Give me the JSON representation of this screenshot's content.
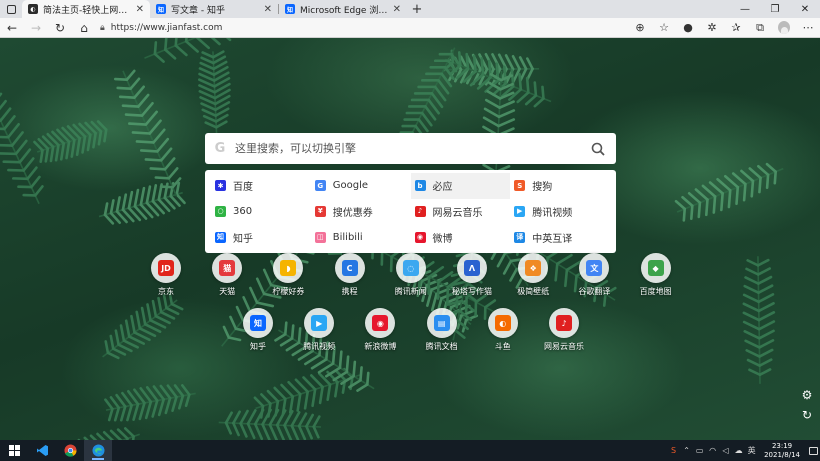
{
  "browser": {
    "tabs": [
      {
        "label": "简法主页-轻快上网体验",
        "active": true,
        "fav_color": "#2b2b2b",
        "fav_text": "◐"
      },
      {
        "label": "写文章 - 知乎",
        "active": false,
        "fav_color": "#0a66ff",
        "fav_text": "知"
      },
      {
        "label": "Microsoft Edge 浏览器及拓展插件",
        "active": false,
        "fav_color": "#0a66ff",
        "fav_text": "知"
      }
    ],
    "address": "https://www.jianfast.com"
  },
  "search": {
    "placeholder": "这里搜索，可以切换引擎",
    "logo": "G"
  },
  "engines": [
    {
      "label": "百度",
      "icon": "paw-icon",
      "color": "#2932e1",
      "glyph": "✱"
    },
    {
      "label": "Google",
      "icon": "google-icon",
      "color": "#4285f4",
      "glyph": "G"
    },
    {
      "label": "必应",
      "icon": "bing-icon",
      "color": "#1e88e5",
      "glyph": "b",
      "highlight": true
    },
    {
      "label": "搜狗",
      "icon": "sogou-icon",
      "color": "#f05a28",
      "glyph": "S"
    },
    {
      "label": "360",
      "icon": "360-icon",
      "color": "#2fb344",
      "glyph": "○"
    },
    {
      "label": "搜优惠券",
      "icon": "coupon-icon",
      "color": "#e53935",
      "glyph": "¥"
    },
    {
      "label": "网易云音乐",
      "icon": "music-icon",
      "color": "#e02020",
      "glyph": "♪"
    },
    {
      "label": "腾讯视频",
      "icon": "video-icon",
      "color": "#2aa6f4",
      "glyph": "▶"
    },
    {
      "label": "知乎",
      "icon": "zhihu-icon",
      "color": "#0a66ff",
      "glyph": "知"
    },
    {
      "label": "Bilibili",
      "icon": "bilibili-icon",
      "color": "#f37299",
      "glyph": "◫"
    },
    {
      "label": "微博",
      "icon": "weibo-icon",
      "color": "#e6162d",
      "glyph": "◉"
    },
    {
      "label": "中英互译",
      "icon": "translate-icon",
      "color": "#1e88e5",
      "glyph": "译"
    }
  ],
  "shortcuts_row1": [
    {
      "label": "京东",
      "icon": "jd-icon",
      "color": "#e1251b",
      "glyph": "JD"
    },
    {
      "label": "天猫",
      "icon": "tmall-icon",
      "color": "#e4393c",
      "glyph": "猫"
    },
    {
      "label": "柠檬好券",
      "icon": "lemon-icon",
      "color": "#f5b400",
      "glyph": "◗"
    },
    {
      "label": "携程",
      "icon": "ctrip-icon",
      "color": "#2577e3",
      "glyph": "C"
    },
    {
      "label": "腾讯新闻",
      "icon": "news-icon",
      "color": "#3ba8f0",
      "glyph": "◌"
    },
    {
      "label": "秘塔写作猫",
      "icon": "metaso-icon",
      "color": "#2a62d0",
      "glyph": "Λ"
    },
    {
      "label": "极简壁纸",
      "icon": "wallpaper-icon",
      "color": "#f08a24",
      "glyph": "❖"
    },
    {
      "label": "谷歌翻译",
      "icon": "gtranslate-icon",
      "color": "#4285f4",
      "glyph": "文"
    },
    {
      "label": "百度地图",
      "icon": "map-icon",
      "color": "#3ca34a",
      "glyph": "◆"
    }
  ],
  "shortcuts_row2": [
    {
      "label": "知乎",
      "icon": "zhihu-icon",
      "color": "#0a66ff",
      "glyph": "知"
    },
    {
      "label": "腾讯视频",
      "icon": "video-icon",
      "color": "#2aa6f4",
      "glyph": "▶"
    },
    {
      "label": "新浪微博",
      "icon": "weibo-icon",
      "color": "#e6162d",
      "glyph": "◉"
    },
    {
      "label": "腾讯文档",
      "icon": "docs-icon",
      "color": "#2a8ef0",
      "glyph": "▤"
    },
    {
      "label": "斗鱼",
      "icon": "douyu-icon",
      "color": "#f56a00",
      "glyph": "◐"
    },
    {
      "label": "网易云音乐",
      "icon": "music-icon",
      "color": "#e02020",
      "glyph": "♪"
    }
  ],
  "taskbar": {
    "time": "23:19",
    "date": "2021/8/14",
    "ime": "英"
  }
}
